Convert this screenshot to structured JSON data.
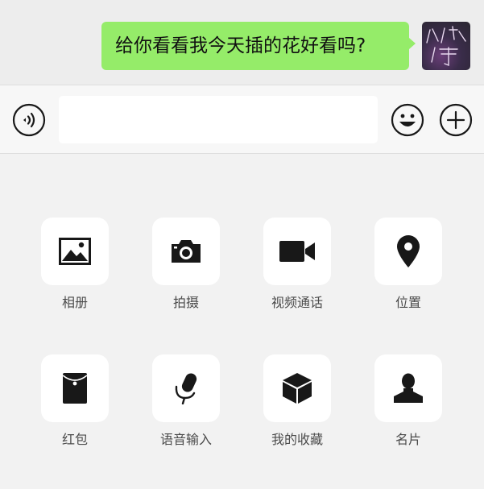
{
  "chat": {
    "message": "给你看看我今天插的花好看吗?",
    "bubble_color": "#95ec69"
  },
  "input_bar": {
    "voice_icon": "voice-icon",
    "text_value": "",
    "emoji_icon": "emoji-icon",
    "more_icon": "plus-icon"
  },
  "tools": [
    {
      "label": "相册",
      "icon": "photo-album-icon"
    },
    {
      "label": "拍摄",
      "icon": "camera-icon"
    },
    {
      "label": "视频通话",
      "icon": "video-call-icon"
    },
    {
      "label": "位置",
      "icon": "location-pin-icon"
    },
    {
      "label": "红包",
      "icon": "red-packet-icon"
    },
    {
      "label": "语音输入",
      "icon": "microphone-icon"
    },
    {
      "label": "我的收藏",
      "icon": "favorites-box-icon"
    },
    {
      "label": "名片",
      "icon": "contact-card-icon"
    }
  ]
}
